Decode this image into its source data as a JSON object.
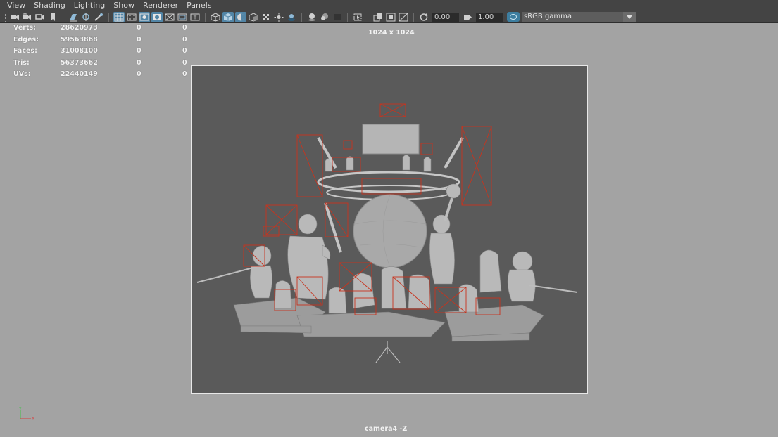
{
  "menu": [
    "View",
    "Shading",
    "Lighting",
    "Show",
    "Renderer",
    "Panels"
  ],
  "toolbar": {
    "field_a": "0.00",
    "field_b": "1.00",
    "color_space": "sRGB gamma"
  },
  "hud": {
    "rows": [
      {
        "label": "Verts:",
        "v1": "28620973",
        "v2": "0",
        "v3": "0"
      },
      {
        "label": "Edges:",
        "v1": "59563868",
        "v2": "0",
        "v3": "0"
      },
      {
        "label": "Faces:",
        "v1": "31008100",
        "v2": "0",
        "v3": "0"
      },
      {
        "label": "Tris:",
        "v1": "56373662",
        "v2": "0",
        "v3": "0"
      },
      {
        "label": "UVs:",
        "v1": "22440149",
        "v2": "0",
        "v3": "0"
      }
    ]
  },
  "viewport": {
    "resolution": "1024 x 1024",
    "camera": "camera4 -Z"
  },
  "axis": {
    "y_label": "Y",
    "x_label": "X"
  },
  "colors": {
    "panel_bg": "#444444",
    "viewport_bg": "#a3a3a3",
    "gate_bg": "#5a5a5a",
    "highlight": "#5285a6",
    "selection_red": "#c8341e"
  }
}
